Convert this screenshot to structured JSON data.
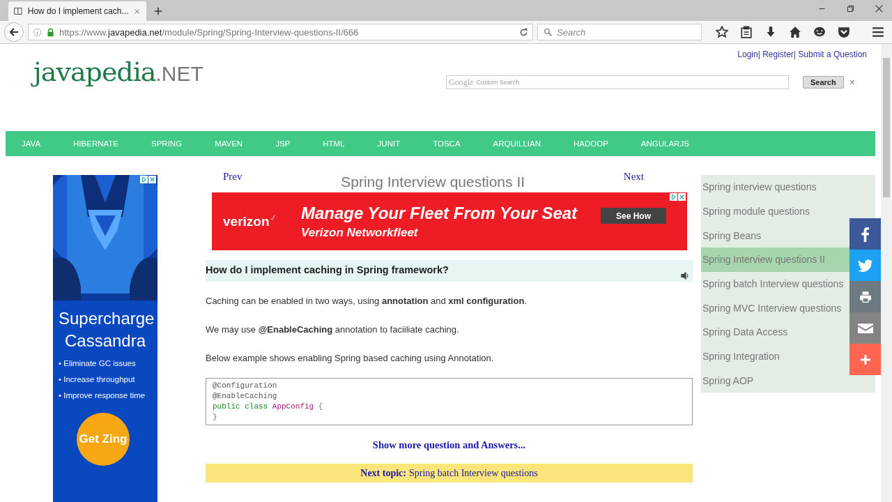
{
  "browser": {
    "tab_title": "How do I implement cach...",
    "url_prefix": "https://www.",
    "url_host": "javapedia.net",
    "url_path": "/module/Spring/Spring-Interview-questions-II/666",
    "search_placeholder": "Search"
  },
  "header": {
    "links": [
      {
        "text": "Login"
      },
      {
        "text": "Register"
      },
      {
        "text": "Submit a Question"
      }
    ],
    "link_separator": "|",
    "logo_name": "javapedia",
    "logo_suffix": ".NET",
    "search_brand": "Google",
    "search_placeholder": "Custom Search",
    "search_button": "Search",
    "clear": "×"
  },
  "nav": [
    "JAVA",
    "HIBERNATE",
    "SPRING",
    "MAVEN",
    "JSP",
    "HTML",
    "JUNIT",
    "TOSCA",
    "ARQUILLIAN",
    "HADOOP",
    "ANGULARJS"
  ],
  "left_ad": {
    "headline": "Supercharge Cassandra",
    "bullets": [
      "• Eliminate GC issues",
      "• Increase throughput",
      "• Improve response time"
    ],
    "cta": "Get Zing"
  },
  "article": {
    "prev": "Prev",
    "title": "Spring Interview questions II",
    "next": "Next",
    "banner": {
      "brand": "verizon",
      "headline": "Manage Your Fleet From Your Seat",
      "subheadline": "Verizon Networkfleet",
      "button": "See How"
    },
    "question": "How do I implement caching in Spring framework?",
    "paragraphs": [
      "Caching can be enabled in two ways, using **annotation** and **xml configuration**.",
      "We may use **@EnableCaching** annotation to faciiliate caching.",
      "Below example shows enabling Spring based caching using Annotation."
    ],
    "code": [
      [
        {
          "kind": "annotation",
          "text": "@Configuration"
        }
      ],
      [
        {
          "kind": "annotation",
          "text": "@EnableCaching"
        }
      ],
      [
        {
          "kind": "keyword",
          "text": "public"
        },
        {
          "kind": "keyword",
          "text": "class"
        },
        {
          "kind": "name",
          "text": "AppConfig"
        },
        {
          "kind": "punct",
          "text": "{"
        }
      ],
      [
        {
          "kind": "punct",
          "text": "}"
        }
      ]
    ],
    "more_link": "Show more question and Answers...",
    "next_topic_label": "Next topic:",
    "next_topic_link": "Spring batch Interview questions"
  },
  "sidebar": [
    {
      "label": "Spring interview questions",
      "selected": false
    },
    {
      "label": "Spring module questions",
      "selected": false
    },
    {
      "label": "Spring Beans",
      "selected": false
    },
    {
      "label": "Spring Interview questions II",
      "selected": true
    },
    {
      "label": "Spring batch Interview questions",
      "selected": false
    },
    {
      "label": "Spring MVC Interview questions",
      "selected": false
    },
    {
      "label": "Spring Data Access",
      "selected": false
    },
    {
      "label": "Spring Integration",
      "selected": false
    },
    {
      "label": "Spring AOP",
      "selected": false
    }
  ],
  "share": [
    {
      "kind": "facebook",
      "color": "#3b5998"
    },
    {
      "kind": "twitter",
      "color": "#1da1f2"
    },
    {
      "kind": "print",
      "color": "#6d7b80"
    },
    {
      "kind": "email",
      "color": "#848484"
    },
    {
      "kind": "more",
      "color": "#ff6550"
    }
  ]
}
